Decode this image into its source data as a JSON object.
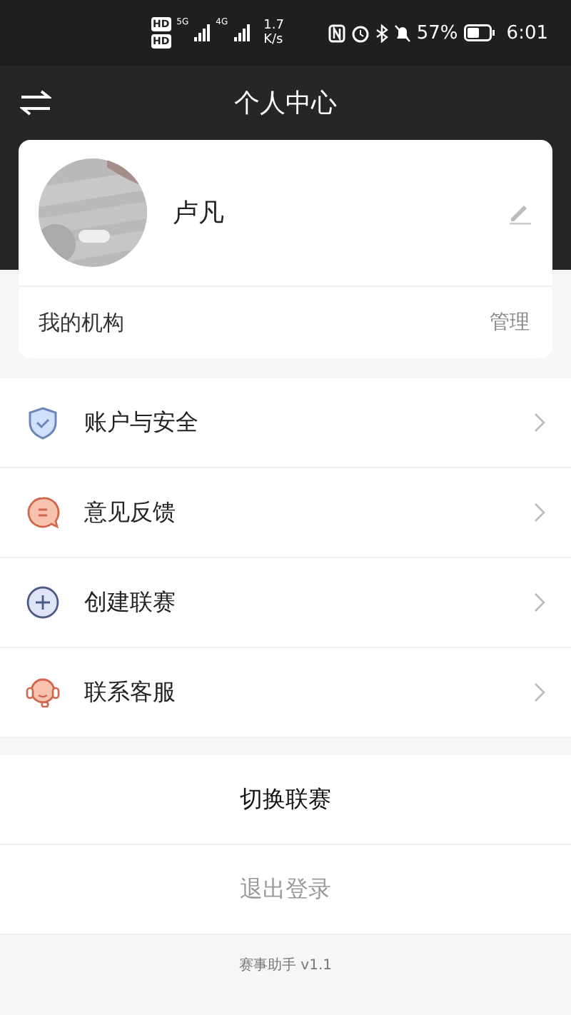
{
  "status_bar": {
    "sim_labels": [
      "HD",
      "HD"
    ],
    "network_labels": [
      "5G",
      "4G"
    ],
    "speed": "1.7",
    "speed_unit": "K/s",
    "battery_text": "57%",
    "time": "6:01"
  },
  "header": {
    "title": "个人中心"
  },
  "profile": {
    "name": "卢凡"
  },
  "organization": {
    "label": "我的机构",
    "action": "管理"
  },
  "menu": [
    {
      "label": "账户与安全",
      "kind": "shield"
    },
    {
      "label": "意见反馈",
      "kind": "feedback"
    },
    {
      "label": "创建联赛",
      "kind": "create"
    },
    {
      "label": "联系客服",
      "kind": "service"
    }
  ],
  "actions": [
    {
      "label": "切换联赛",
      "kind": "primary"
    },
    {
      "label": "退出登录",
      "kind": "muted"
    }
  ],
  "footer": {
    "version": "赛事助手 v1.1"
  }
}
